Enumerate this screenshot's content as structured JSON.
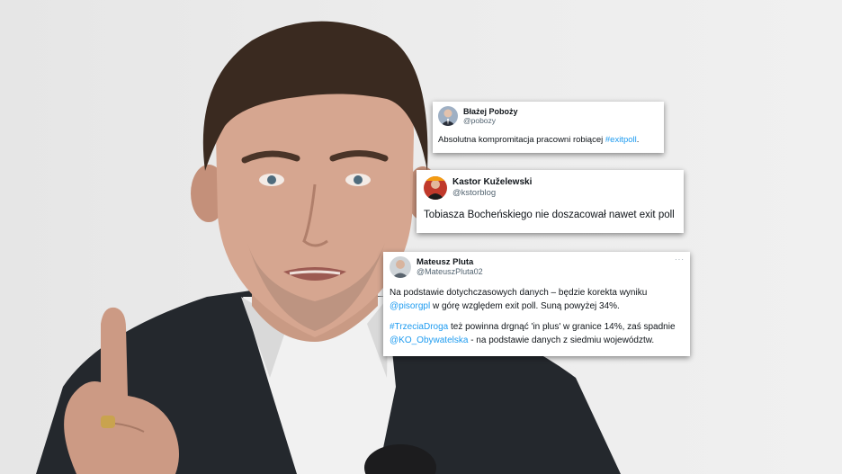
{
  "tweets": [
    {
      "name": "Błażej Poboży",
      "handle": "@pobozy",
      "text_before": "Absolutna kompromitacja pracowni robiącej ",
      "link": "#exitpoll",
      "text_after": "."
    },
    {
      "name": "Kastor Kuželewski",
      "handle": "@kstorblog",
      "text": "Tobiasza Bocheńskiego nie doszacował nawet exit poll"
    },
    {
      "name": "Mateusz Pluta",
      "handle": "@MateuszPluta02",
      "line1": "Na podstawie dotychczasowych danych – będzie korekta wyniku",
      "mention1": "@pisorgpl",
      "line2_rest": " w górę względem exit poll. Suną powyżej 34%.",
      "hashtag": "#TrzeciaDroga",
      "line3_rest": " też powinna drgnąć 'in plus' w granice 14%, zaś spadnie",
      "mention2": "@KO_Obywatelska",
      "line4_rest": " - na podstawie danych z siedmiu województw."
    }
  ],
  "colors": {
    "link": "#1d9bf0",
    "handle": "#536471",
    "background": "#ececec"
  },
  "icons": {
    "more": "more-dots-icon"
  }
}
